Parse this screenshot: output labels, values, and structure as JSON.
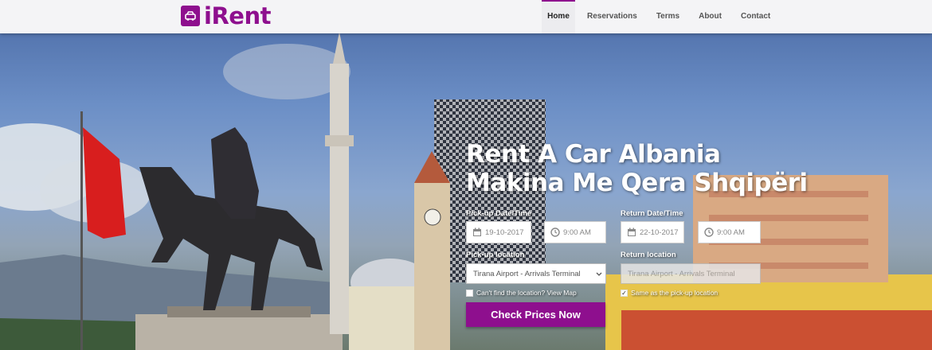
{
  "brand": {
    "name": "iRent",
    "color": "#8e0f8e"
  },
  "nav": {
    "items": [
      "Home",
      "Reservations",
      "Terms",
      "About",
      "Contact"
    ],
    "active": "Home"
  },
  "hero": {
    "line1": "Rent A Car Albania",
    "line2": "Makina Me Qera Shqipëri"
  },
  "form": {
    "pickup_datetime_label": "Pick-up Date/Time",
    "pickup_date": "19-10-2017",
    "pickup_time": "9:00 AM",
    "return_datetime_label": "Return Date/Time",
    "return_date": "22-10-2017",
    "return_time": "9:00 AM",
    "pickup_location_label": "Pick-up location",
    "pickup_location": "Tirana Airport - Arrivals Terminal",
    "return_location_label": "Return location",
    "return_location": "Tirana Airport - Arrivals Terminal",
    "cant_find_text": "Can't find the location? View Map",
    "same_as_pickup_text": "Same as the pick-up location",
    "submit_label": "Check Prices Now"
  },
  "icons": [
    "car-icon",
    "calendar-icon",
    "clock-icon",
    "chevron-down-icon"
  ]
}
